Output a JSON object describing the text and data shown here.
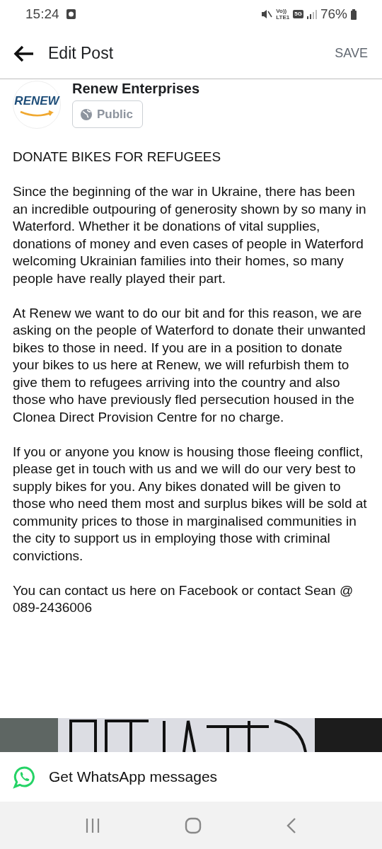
{
  "status_bar": {
    "time": "15:24",
    "volte": "Vo))",
    "lte": "LTE1",
    "network": "5G",
    "battery": "76%"
  },
  "header": {
    "title": "Edit Post",
    "action": "SAVE"
  },
  "author": {
    "name": "Renew Enterprises",
    "logo_text": "RENEW",
    "audience": "Public"
  },
  "post": {
    "title": "DONATE BIKES FOR REFUGEES",
    "paragraphs": [
      "Since the beginning of the war in Ukraine, there has been an incredible outpouring of generosity shown by so many in Waterford. Whether it be donations of vital supplies, donations of money and even cases of people in Waterford welcoming Ukrainian families into their homes, so many people have really played their part.",
      "At Renew we want to do our bit and for this reason, we are asking on the people of Waterford to donate their unwanted bikes to those in need. If you are in a position to donate your bikes to us here at Renew, we will refurbish them to give them to refugees arriving into the country and also those who have previously fled persecution housed in the Clonea Direct Provision Centre for no charge.",
      "If you or anyone you know is housing those fleeing conflict, please get in touch with us and we will do our very best to supply bikes for you. Any bikes donated will be given to those who need them most and surplus bikes will be sold at community prices to those in marginalised communities in the city to support us in employing those with criminal convictions.",
      "You can contact us here on Facebook or contact Sean @ 089-2436006"
    ]
  },
  "whatsapp_bar": {
    "label": "Get WhatsApp messages"
  }
}
